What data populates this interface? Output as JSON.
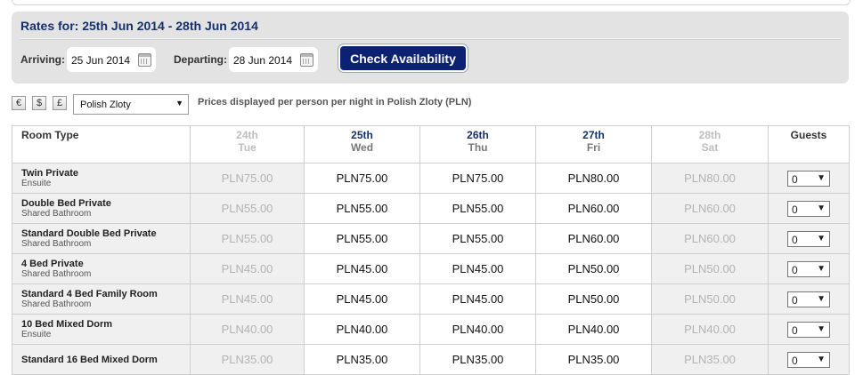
{
  "rates": {
    "title": "Rates for: 25th Jun 2014 - 28th Jun 2014",
    "arriving_label": "Arriving:",
    "arriving_value": "25 Jun 2014",
    "departing_label": "Departing:",
    "departing_value": "28 Jun 2014",
    "check_label": "Check Availability"
  },
  "currency": {
    "buttons": [
      "€",
      "$",
      "£"
    ],
    "selected": "Polish Zloty",
    "note": "Prices displayed per person per night in Polish Zloty (PLN)"
  },
  "table": {
    "room_type_header": "Room Type",
    "guests_header": "Guests",
    "days": [
      {
        "date": "24th",
        "weekday": "Tue",
        "active": false
      },
      {
        "date": "25th",
        "weekday": "Wed",
        "active": true
      },
      {
        "date": "26th",
        "weekday": "Thu",
        "active": true
      },
      {
        "date": "27th",
        "weekday": "Fri",
        "active": true
      },
      {
        "date": "28th",
        "weekday": "Sat",
        "active": false
      }
    ],
    "rows": [
      {
        "name": "Twin Private",
        "sub": "Ensuite",
        "prices": [
          "PLN75.00",
          "PLN75.00",
          "PLN75.00",
          "PLN80.00",
          "PLN80.00"
        ],
        "guests": "0"
      },
      {
        "name": "Double Bed Private",
        "sub": "Shared Bathroom",
        "prices": [
          "PLN55.00",
          "PLN55.00",
          "PLN55.00",
          "PLN60.00",
          "PLN60.00"
        ],
        "guests": "0"
      },
      {
        "name": "Standard Double Bed Private",
        "sub": "Shared Bathroom",
        "prices": [
          "PLN55.00",
          "PLN55.00",
          "PLN55.00",
          "PLN60.00",
          "PLN60.00"
        ],
        "guests": "0"
      },
      {
        "name": "4 Bed Private",
        "sub": "Shared Bathroom",
        "prices": [
          "PLN45.00",
          "PLN45.00",
          "PLN45.00",
          "PLN50.00",
          "PLN50.00"
        ],
        "guests": "0"
      },
      {
        "name": "Standard 4 Bed Family Room",
        "sub": "Shared Bathroom",
        "prices": [
          "PLN45.00",
          "PLN45.00",
          "PLN45.00",
          "PLN50.00",
          "PLN50.00"
        ],
        "guests": "0"
      },
      {
        "name": "10 Bed Mixed Dorm",
        "sub": "Ensuite",
        "prices": [
          "PLN40.00",
          "PLN40.00",
          "PLN40.00",
          "PLN40.00",
          "PLN40.00"
        ],
        "guests": "0"
      },
      {
        "name": "Standard 16 Bed Mixed Dorm",
        "sub": "",
        "prices": [
          "PLN35.00",
          "PLN35.00",
          "PLN35.00",
          "PLN35.00",
          "PLN35.00"
        ],
        "guests": "0"
      }
    ]
  },
  "icons": {
    "calendar": "calendar-icon",
    "dropdown": "chevron-down-icon"
  },
  "colors": {
    "brand": "#0b2171",
    "title": "#16306d",
    "inactive_text": "#b3b3b3"
  }
}
